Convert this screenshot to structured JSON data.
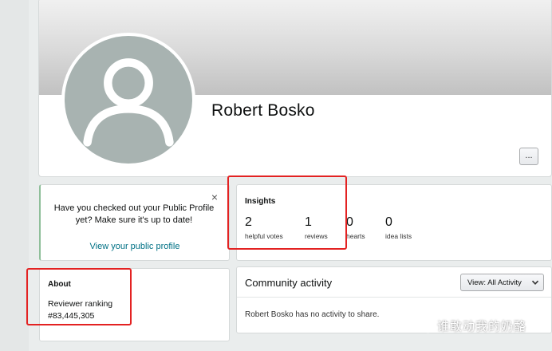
{
  "profile": {
    "name": "Robert Bosko",
    "more_label": "..."
  },
  "notice": {
    "text": "Have you checked out your Public Profile yet? Make sure it's up to date!",
    "close_label": "×",
    "link": "View your public profile"
  },
  "insights": {
    "title": "Insights",
    "stats": [
      {
        "value": "2",
        "label": "helpful votes"
      },
      {
        "value": "1",
        "label": "reviews"
      },
      {
        "value": "0",
        "label": "hearts"
      },
      {
        "value": "0",
        "label": "idea lists"
      }
    ]
  },
  "about": {
    "title": "About",
    "ranking_label": "Reviewer ranking",
    "ranking_value": "#83,445,305"
  },
  "activity": {
    "title": "Community activity",
    "dropdown_label": "View: All Activity",
    "empty_text": "Robert Bosko has no activity to share."
  },
  "watermark": {
    "text": "谁敢动我的奶酪"
  },
  "colors": {
    "highlight": "#e32222",
    "link": "#007185",
    "avatar_bg": "#a8b3b1"
  }
}
